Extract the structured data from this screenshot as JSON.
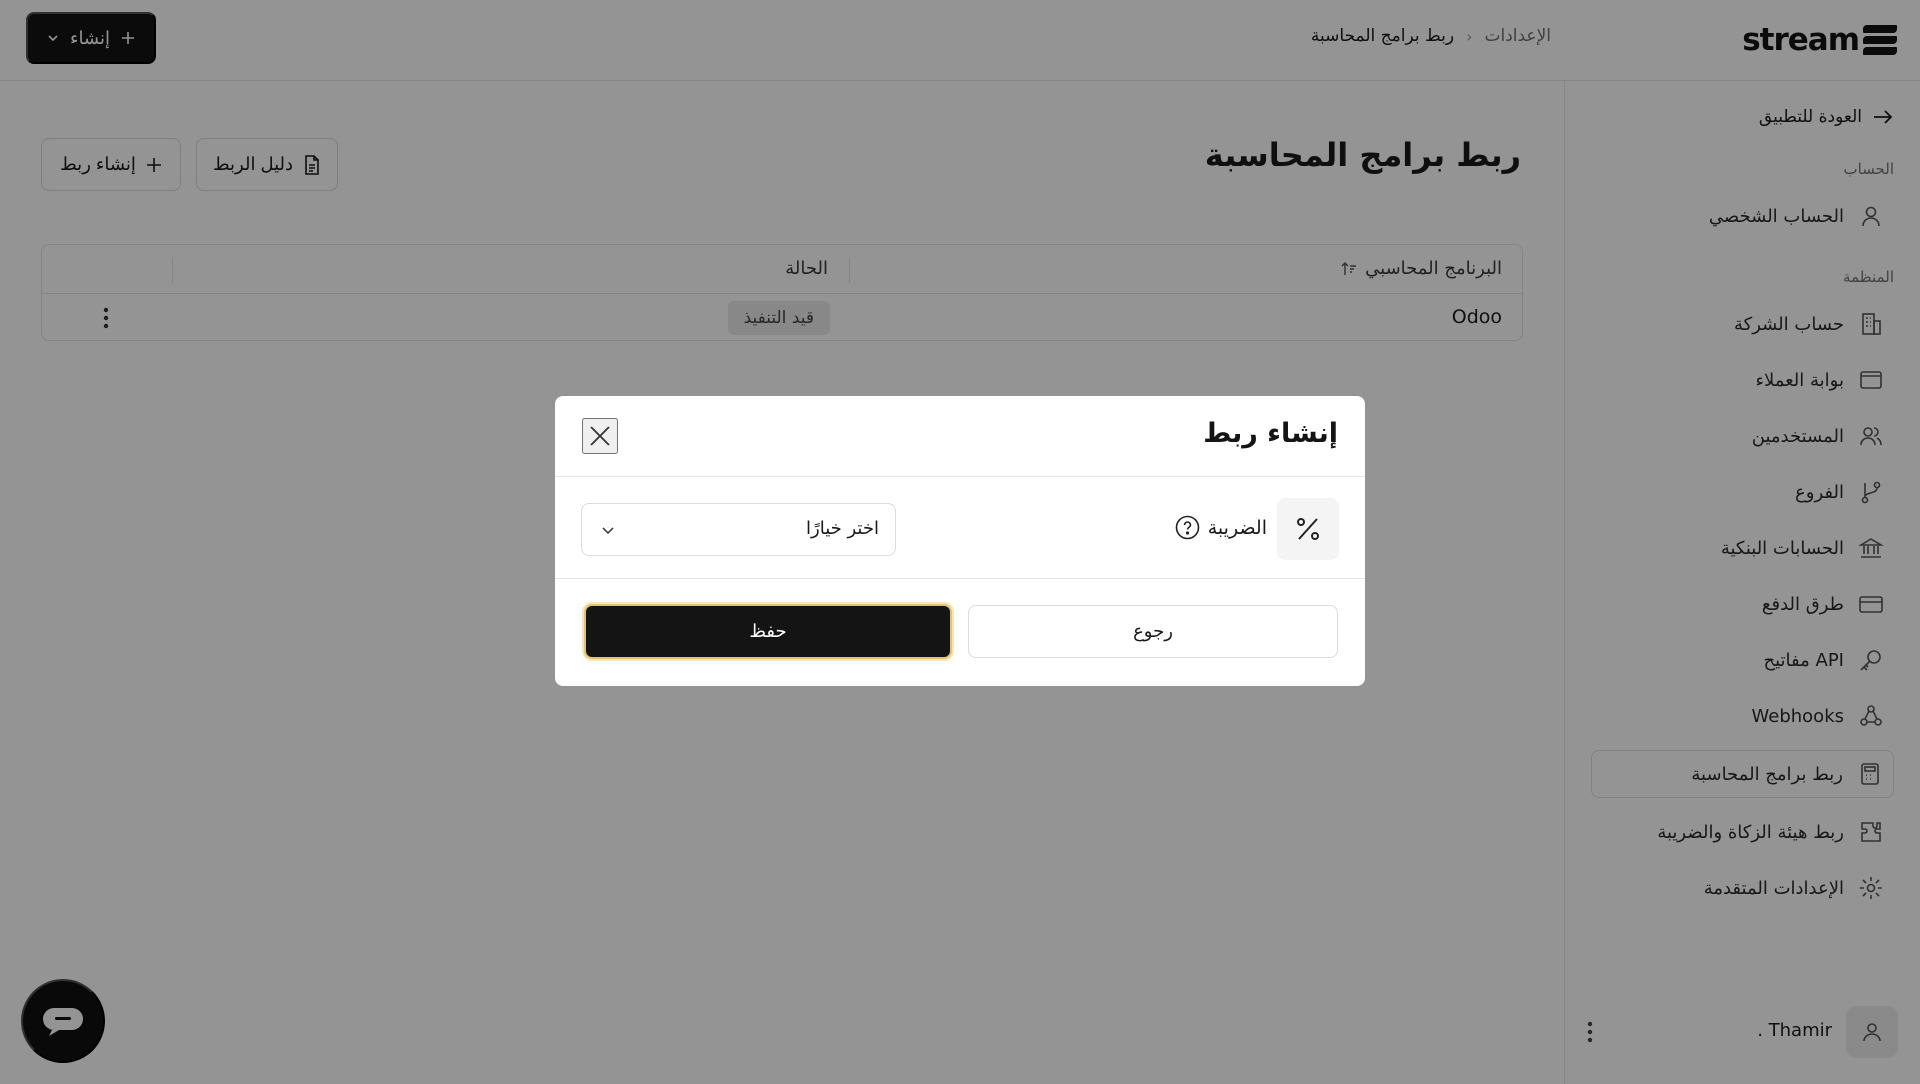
{
  "topbar": {
    "logo_text": "stream",
    "breadcrumb": {
      "root": "الإعدادات",
      "separator": "›",
      "current": "ربط برامج المحاسبة"
    },
    "create_button_label": "إنشاء"
  },
  "sidebar": {
    "back_label": "العودة للتطبيق",
    "sections": {
      "account": "الحساب",
      "organization": "المنظمة"
    },
    "items": [
      {
        "label": "الحساب الشخصي",
        "icon": "user-icon"
      },
      {
        "label": "حساب الشركة",
        "icon": "building-icon"
      },
      {
        "label": "بوابة العملاء",
        "icon": "window-icon"
      },
      {
        "label": "المستخدمين",
        "icon": "users-icon"
      },
      {
        "label": "الفروع",
        "icon": "branch-icon"
      },
      {
        "label": "الحسابات البنكية",
        "icon": "bank-icon"
      },
      {
        "label": "طرق الدفع",
        "icon": "credit-card-icon"
      },
      {
        "label": "مفاتيح API",
        "icon": "key-icon"
      },
      {
        "label": "Webhooks",
        "icon": "webhook-icon"
      },
      {
        "label": "ربط برامج المحاسبة",
        "icon": "calculator-icon",
        "active": true
      },
      {
        "label": "ربط هيئة الزكاة والضريبة",
        "icon": "puzzle-icon"
      },
      {
        "label": "الإعدادات المتقدمة",
        "icon": "gear-icon"
      }
    ],
    "user": {
      "name": ". Thamir"
    }
  },
  "main": {
    "title": "ربط برامج المحاسبة",
    "guide_button_label": "دليل الربط",
    "create_link_button_label": "إنشاء ربط",
    "table": {
      "columns": [
        "البرنامج المحاسبي",
        "الحالة"
      ],
      "rows": [
        {
          "program": "Odoo",
          "status": "قيد التنفيذ"
        }
      ]
    }
  },
  "modal": {
    "title": "إنشاء ربط",
    "tax_label": "الضريبة",
    "tax_select_value": "اختر خيارًا",
    "save_label": "حفظ",
    "back_label": "رجوع"
  },
  "colors": {
    "primary": "#141414",
    "overlay": "rgba(0,0,0,0.42)",
    "focus_ring": "#e3c46a",
    "badge_bg": "#ebebeb"
  }
}
